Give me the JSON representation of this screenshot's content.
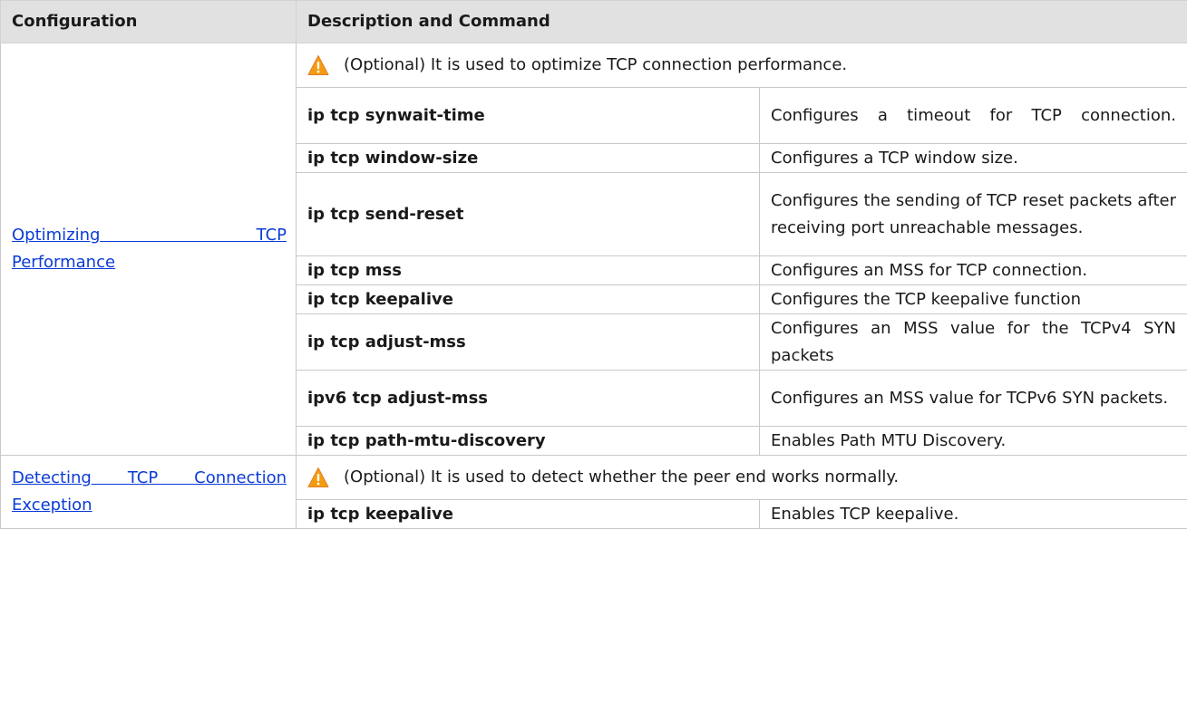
{
  "table": {
    "headers": {
      "configuration": "Configuration",
      "description": "Description and Command"
    },
    "sections": [
      {
        "configuration_line1": "Optimizing TCP",
        "configuration_line2": "Performance",
        "note": "(Optional) It is used to optimize TCP connection performance.",
        "rows": [
          {
            "command": "ip tcp synwait-time",
            "description": "Configures a timeout for TCP connection."
          },
          {
            "command": "ip tcp window-size",
            "description": "Configures a TCP window size."
          },
          {
            "command": "ip tcp send-reset",
            "description": "Configures the sending of TCP reset packets after receiving port unreachable messages."
          },
          {
            "command": "ip tcp mss",
            "description": "Configures an MSS for TCP connection."
          },
          {
            "command": "ip tcp keepalive",
            "description": "Configures the TCP keepalive function"
          },
          {
            "command": "ip tcp adjust-mss",
            "description": "Configures an MSS value for the TCPv4 SYN packets"
          },
          {
            "command": "ipv6 tcp adjust-mss",
            "description": "Configures an MSS value for TCPv6 SYN packets."
          },
          {
            "command": "ip tcp path-mtu-discovery",
            "description": "Enables Path MTU Discovery."
          }
        ]
      },
      {
        "configuration_line1": "Detecting TCP Connection",
        "configuration_line2": "Exception",
        "note": "(Optional) It is used to detect whether the peer end works normally.",
        "rows": [
          {
            "command": "ip tcp keepalive",
            "description": "Enables TCP keepalive."
          }
        ]
      }
    ]
  },
  "icons": {
    "note_icon": "warning-triangle-icon",
    "warning_color": "#f39c12"
  }
}
